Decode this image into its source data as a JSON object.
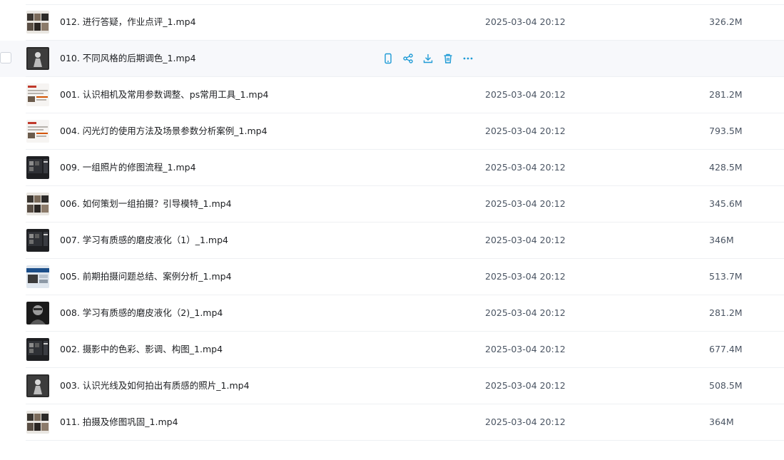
{
  "colors": {
    "accent": "#1f9bd6",
    "hover_bg": "#f7f8fb",
    "divider": "#eef0f3"
  },
  "row_actions": [
    "phone-icon",
    "share-icon",
    "download-icon",
    "delete-icon",
    "more-icon"
  ],
  "files": [
    {
      "name": "012. 进行答疑，作业点评_1.mp4",
      "date": "2025-03-04 20:12",
      "size": "326.2M",
      "thumb": "grid-light"
    },
    {
      "name": "010. 不同风格的后期调色_1.mp4",
      "date": "",
      "size": "",
      "thumb": "dark-figure",
      "hovered": true
    },
    {
      "name": "001. 认识相机及常用参数调整、ps常用工具_1.mp4",
      "date": "2025-03-04 20:12",
      "size": "281.2M",
      "thumb": "doc-red"
    },
    {
      "name": "004. 闪光灯的使用方法及场景参数分析案例_1.mp4",
      "date": "2025-03-04 20:12",
      "size": "793.5M",
      "thumb": "doc-red"
    },
    {
      "name": "009. 一组照片的修图流程_1.mp4",
      "date": "2025-03-04 20:12",
      "size": "428.5M",
      "thumb": "dark-ui"
    },
    {
      "name": "006. 如何策划一组拍摄？引导模特_1.mp4",
      "date": "2025-03-04 20:12",
      "size": "345.6M",
      "thumb": "grid-light"
    },
    {
      "name": "007. 学习有质感的磨皮液化（1）_1.mp4",
      "date": "2025-03-04 20:12",
      "size": "346M",
      "thumb": "dark-ui"
    },
    {
      "name": "005. 前期拍摄问题总结、案例分析_1.mp4",
      "date": "2025-03-04 20:12",
      "size": "513.7M",
      "thumb": "blue-ui"
    },
    {
      "name": "008. 学习有质感的磨皮液化（2)_1.mp4",
      "date": "2025-03-04 20:12",
      "size": "281.2M",
      "thumb": "portrait"
    },
    {
      "name": "002. 摄影中的色彩、影调、构图_1.mp4",
      "date": "2025-03-04 20:12",
      "size": "677.4M",
      "thumb": "dark-ui"
    },
    {
      "name": "003. 认识光线及如何拍出有质感的照片_1.mp4",
      "date": "2025-03-04 20:12",
      "size": "508.5M",
      "thumb": "dark-figure"
    },
    {
      "name": "011. 拍摄及修图巩固_1.mp4",
      "date": "2025-03-04 20:12",
      "size": "364M",
      "thumb": "grid-light"
    }
  ]
}
